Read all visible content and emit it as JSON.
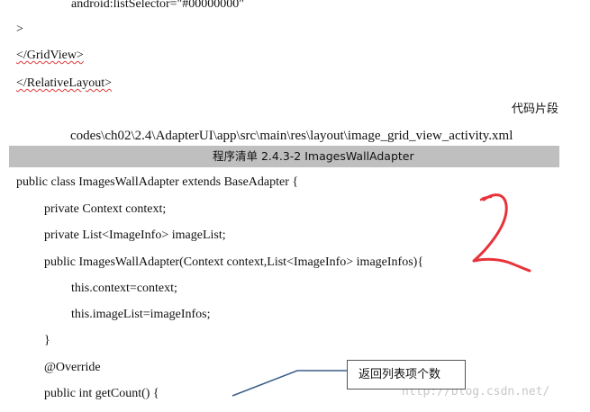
{
  "code_top": {
    "list_selector": "android:listSelector=\"#00000000\"",
    "close_angle": ">",
    "end_gridview": "</GridView>",
    "end_relativelayout": "</RelativeLayout>"
  },
  "snippet_label": "代码片段",
  "file_path": "codes\\ch02\\2.4\\AdapterUI\\app\\src\\main\\res\\layout\\image_grid_view_activity.xml",
  "listing_title": "程序清单 2.4.3-2 ImagesWallAdapter",
  "code_main": {
    "class_decl": "public class ImagesWallAdapter extends BaseAdapter {",
    "field_context": "private Context context;",
    "field_list": "private List<ImageInfo> imageList;",
    "constructor": "public ImagesWallAdapter(Context context,List<ImageInfo> imageInfos){",
    "assign_context": "this.context=context;",
    "assign_list": "this.imageList=imageInfos;",
    "close_brace": "}",
    "override": "@Override",
    "get_count": "public int getCount() {"
  },
  "annotation": {
    "callout_text": "返回列表项个数",
    "handwritten_mark": "2",
    "mark_color": "#e8333a"
  },
  "watermark": "http://blog.csdn.net/",
  "colors": {
    "banner_bg": "#bfbfbf",
    "spellcheck_underline": "#e23b3b"
  }
}
